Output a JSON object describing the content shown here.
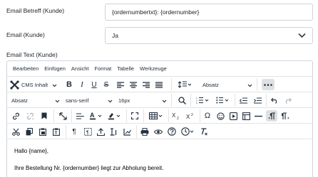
{
  "form": {
    "subject_label": "Email Betreff (Kunde)",
    "subject_value": "{ordernumbertxt}: {ordernumber}",
    "email_label": "Email (Kunde)",
    "email_value": "Ja",
    "text_label": "Email Text (Kunde)"
  },
  "editor": {
    "menu": [
      "Bearbeiten",
      "Einfügen",
      "Ansicht",
      "Format",
      "Tabelle",
      "Werkzeuge"
    ],
    "cms_label": "CMS Inhalt",
    "paragraph_format": "Absatz",
    "block_format": "Absatz",
    "font_family": "sans-serif",
    "font_size": "16px",
    "content": {
      "line1": "Hallo {name},",
      "line2": "Ihre Bestellung Nr. {ordernumber} liegt zur Abholung bereit."
    }
  },
  "colors": {
    "border": "#ced4da",
    "toolbar_icon": "#222f3e",
    "active_bg": "#dee0e2"
  }
}
